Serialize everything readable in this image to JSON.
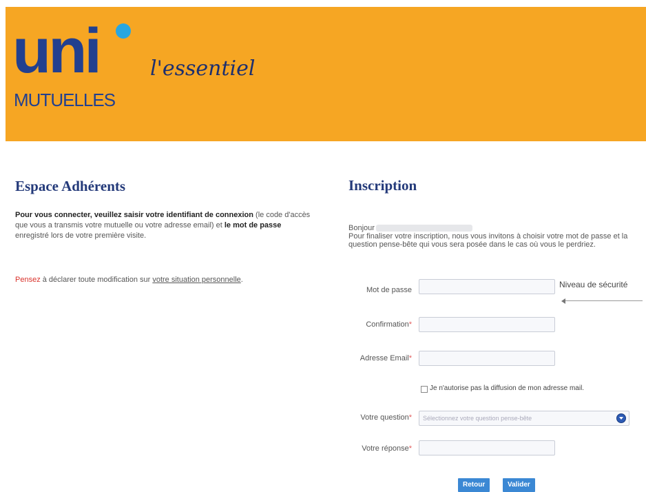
{
  "header": {
    "logo_main": "uni",
    "logo_sub": "MUTUELLES",
    "tagline": "l'essentiel",
    "colors": {
      "background": "#f6a623",
      "logo_blue": "#22408f",
      "logo_accent": "#29a6e0"
    }
  },
  "left": {
    "title": "Espace Adhérents",
    "intro_bold": "Pour vous connecter, veuillez saisir votre identifiant de connexion",
    "intro_rest": " (le code d'accès que vous a transmis votre mutuelle ou votre adresse email) et ",
    "intro_bold2": "le mot de passe",
    "intro_end": " enregistré lors de votre première visite.",
    "reminder_prefix": "Pensez",
    "reminder_text": " à déclarer toute modification sur ",
    "reminder_link": "votre situation personnelle",
    "reminder_end": "."
  },
  "right": {
    "title": "Inscription",
    "greeting": "Bonjour",
    "intro": "Pour finaliser votre inscription, nous vous invitons à choisir votre mot de passe et la question pense-bête qui vous sera posée dans le cas où vous le perdriez.",
    "fields": {
      "password_label": "Mot de passe",
      "strength_label": "Niveau de sécurité",
      "confirmation_label": "Confirmation",
      "email_label": "Adresse Email",
      "checkbox_label": "Je n'autorise pas la diffusion de mon adresse mail.",
      "question_label": "Votre question",
      "question_placeholder": "Sélectionnez votre question pense-bête",
      "answer_label": "Votre réponse",
      "required_mark": "*"
    },
    "buttons": {
      "back": "Retour",
      "submit": "Valider"
    }
  }
}
